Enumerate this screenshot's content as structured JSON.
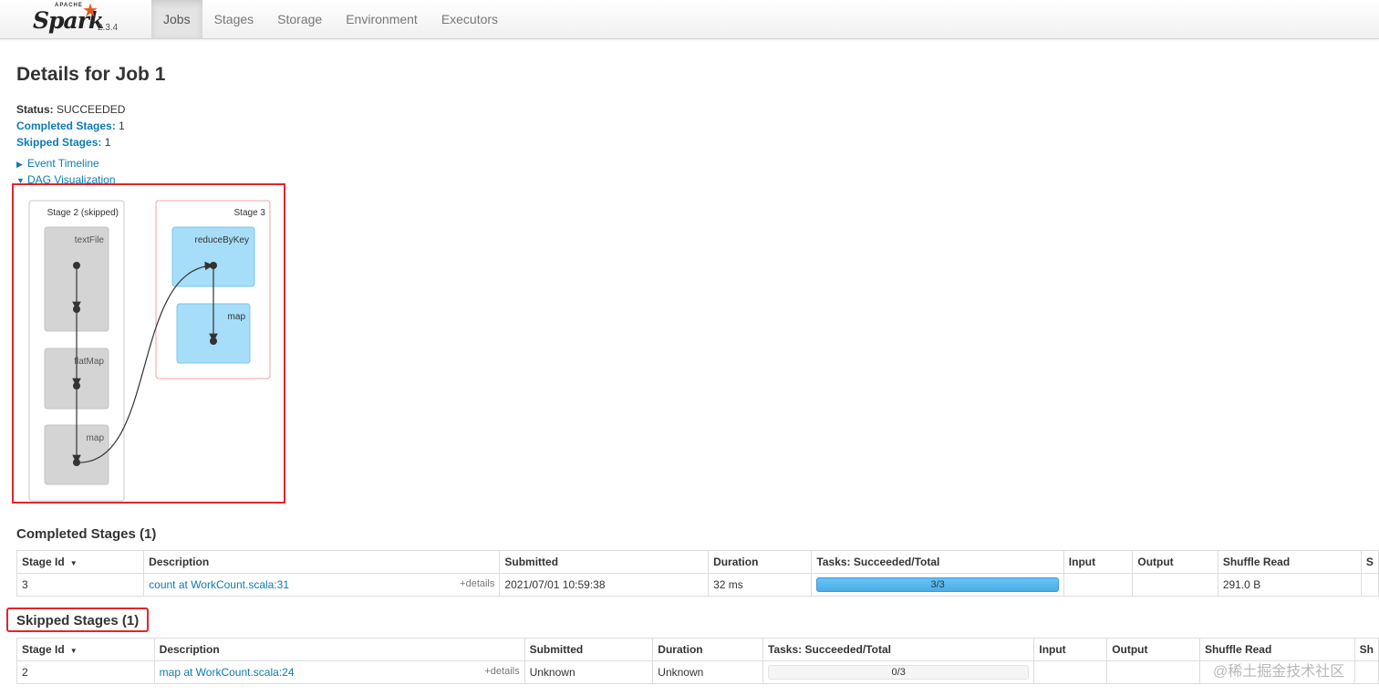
{
  "brand": {
    "apache": "APACHE",
    "name": "Spark",
    "version": "2.3.4"
  },
  "nav": [
    "Jobs",
    "Stages",
    "Storage",
    "Environment",
    "Executors"
  ],
  "page_title": "Details for Job 1",
  "summary": {
    "status_label": "Status:",
    "status_value": "SUCCEEDED",
    "completed_label": "Completed Stages:",
    "completed_value": "1",
    "skipped_label": "Skipped Stages:",
    "skipped_value": "1"
  },
  "event_timeline": "Event Timeline",
  "dag_visualization": "DAG Visualization",
  "dag": {
    "stage2": {
      "label": "Stage 2 (skipped)",
      "ops": [
        "textFile",
        "flatMap",
        "map"
      ]
    },
    "stage3": {
      "label": "Stage 3",
      "ops": [
        "reduceByKey",
        "map"
      ]
    }
  },
  "completed": {
    "title": "Completed Stages (1)",
    "headers": [
      "Stage Id",
      "Description",
      "Submitted",
      "Duration",
      "Tasks: Succeeded/Total",
      "Input",
      "Output",
      "Shuffle Read",
      "S"
    ],
    "row": {
      "stage_id": "3",
      "description": "count at WorkCount.scala:31",
      "details": "+details",
      "submitted": "2021/07/01 10:59:38",
      "duration": "32 ms",
      "tasks": "3/3",
      "tasks_progress": 1.0,
      "input": "",
      "output": "",
      "shuffle_read": "291.0 B"
    }
  },
  "skipped": {
    "title": "Skipped Stages (1)",
    "headers": [
      "Stage Id",
      "Description",
      "Submitted",
      "Duration",
      "Tasks: Succeeded/Total",
      "Input",
      "Output",
      "Shuffle Read",
      "Sh"
    ],
    "row": {
      "stage_id": "2",
      "description": "map at WorkCount.scala:24",
      "details": "+details",
      "submitted": "Unknown",
      "duration": "Unknown",
      "tasks": "0/3",
      "tasks_progress": 0.0,
      "input": "",
      "output": "",
      "shuffle_read": ""
    }
  },
  "watermark": "@稀土掘金技术社区",
  "colors": {
    "link": "#0f7ab4",
    "highlight_box": "#e0262b",
    "stage_done": "#a6ddf8",
    "stage_skipped": "#d4d4d4"
  }
}
